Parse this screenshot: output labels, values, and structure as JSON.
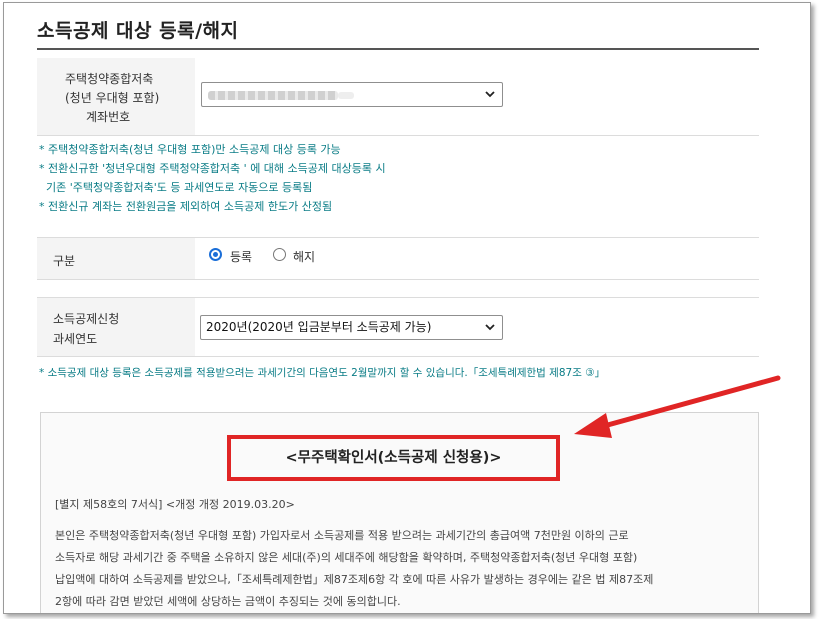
{
  "page": {
    "title": "소득공제 대상 등록/해지"
  },
  "account": {
    "label_line1": "주택청약종합저축",
    "label_line2": "(청년 우대형 포함)",
    "label_line3": "계좌번호",
    "selected_value": ""
  },
  "notes_top": [
    "* 주택청약종합저축(청년 우대형 포함)만 소득공제 대상 등록 가능",
    "* 전환신규한 '청년우대형 주택청약종합저축 ' 에 대해 소득공제 대상등록 시",
    "  기존 '주택청약종합저축'도 등 과세연도로 자동으로 등록됨",
    "* 전환신규 계좌는 전환원금을 제외하여 소득공제 한도가 산정됨"
  ],
  "category": {
    "label": "구분",
    "options": [
      "등록",
      "해지"
    ],
    "selected": "등록"
  },
  "tax_year": {
    "label_line1": "소득공제신청",
    "label_line2": "과세연도",
    "selected_value": "2020년(2020년 입금분부터 소득공제 가능)"
  },
  "note_bottom": "* 소득공제 대상 등록은 소득공제를 적용받으려는 과세기간의 다음연도 2월말까지 할 수 있습니다.「조세특례제한법 제87조 ③」",
  "certificate": {
    "title": "<무주택확인서(소득공제 신청용)>",
    "form_ref": "[별지 제58호의 7서식]  <개정 개정 2019.03.20>",
    "body_lines": [
      "본인은 주택청약종합저축(청년 우대형 포함) 가입자로서 소득공제를 적용 받으려는 과세기간의 총급여액 7천만원 이하의 근로",
      "소득자로 해당 과세기간 중 주택을 소유하지 않은 세대(주)의 세대주에 해당함을 확약하며, 주택청약종합저축(청년 우대형 포함)",
      "납입액에 대하여 소득공제를 받았으나,「조세특례제한법」제87조제6항 각 호에 따른 사유가 발생하는 경우에는 같은 법 제87조제",
      "2항에 따라 감면 받았던 세액에 상당하는 금액이 추징되는 것에 동의합니다."
    ]
  },
  "colors": {
    "note_text": "#0a7c86",
    "highlight_red": "#e02525",
    "radio_blue": "#1a6ed8"
  }
}
